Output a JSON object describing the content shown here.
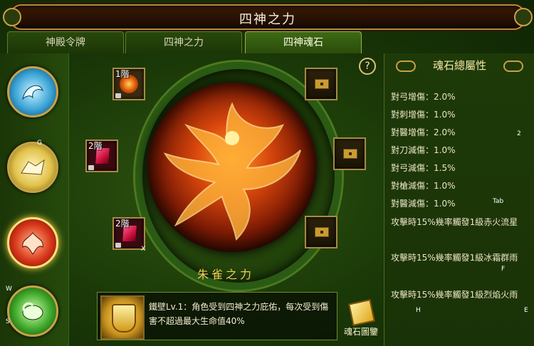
{
  "window": {
    "title": "四神之力"
  },
  "tabs": [
    {
      "label": "神殿令牌",
      "active": false
    },
    {
      "label": "四神之力",
      "active": false
    },
    {
      "label": "四神魂石",
      "active": true
    }
  ],
  "beasts": [
    {
      "name": "azure-dragon",
      "color": "#3aa3d6",
      "selected": false
    },
    {
      "name": "white-tiger",
      "color": "#e2c24a",
      "selected": false
    },
    {
      "name": "vermilion-bird",
      "color": "#d8361a",
      "selected": true
    },
    {
      "name": "black-tortoise",
      "color": "#3fa82a",
      "selected": false
    }
  ],
  "hotkeys": {
    "g": "G",
    "w": "W",
    "s": "S",
    "x": "X",
    "tab": "Tab",
    "f": "F",
    "h": "H",
    "e": "E",
    "two": "2"
  },
  "slots": [
    {
      "level": "1階",
      "type": "fire"
    },
    {
      "level": "2階",
      "type": "red-gem"
    },
    {
      "level": "2階",
      "type": "red-gem"
    }
  ],
  "guardian_name": "朱雀之力",
  "skill": {
    "text": "鐵壁Lv.1：角色受到四神之力庇佑，每次受到傷害不超過最大生命值40%"
  },
  "book_button": {
    "label": "魂石圖鑒"
  },
  "help_label": "?",
  "stats_panel": {
    "title": "魂石總屬性",
    "attributes": [
      {
        "label": "對弓增傷：",
        "value": "2.0%"
      },
      {
        "label": "對刺增傷：",
        "value": "1.0%"
      },
      {
        "label": "對醫增傷：",
        "value": "2.0%"
      },
      {
        "label": "對刀減傷：",
        "value": "1.0%"
      },
      {
        "label": "對弓減傷：",
        "value": "1.5%"
      },
      {
        "label": "對槍減傷：",
        "value": "1.0%"
      },
      {
        "label": "對醫減傷：",
        "value": "1.0%"
      }
    ],
    "effects": [
      "攻擊時15%幾率觸發1級赤火流星",
      "攻擊時15%幾率觸發1級冰霜群雨",
      "攻擊時15%幾率觸發1級烈焰火雨"
    ]
  }
}
